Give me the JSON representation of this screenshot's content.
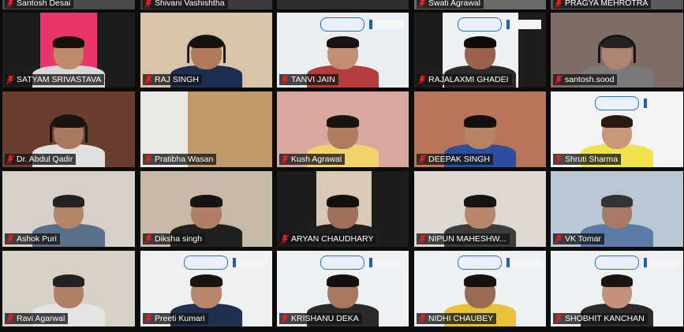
{
  "participants": [
    {
      "name": "Santosh Desai"
    },
    {
      "name": "Shivani Vashishtha"
    },
    {
      "name": ""
    },
    {
      "name": "Swati Agrawal"
    },
    {
      "name": "PRAGYA MEHROTRA"
    },
    {
      "name": "SATYAM SRIVASTAVA"
    },
    {
      "name": "RAJ SINGH"
    },
    {
      "name": "TANVI JAIN"
    },
    {
      "name": "RAJALAXMI GHADEI"
    },
    {
      "name": "santosh.sood"
    },
    {
      "name": "Dr. Abdul Qadir"
    },
    {
      "name": "Pratibha Wasan"
    },
    {
      "name": "Kush Agrawal"
    },
    {
      "name": "DEEPAK SINGH"
    },
    {
      "name": "Shruti Sharma"
    },
    {
      "name": "Ashok Puri"
    },
    {
      "name": "Diksha singh"
    },
    {
      "name": "ARYAN CHAUDHARY"
    },
    {
      "name": "NIPUN MAHESHW..."
    },
    {
      "name": "VK Tomar"
    },
    {
      "name": "Ravi Agarwal"
    },
    {
      "name": "Preeti Kumari"
    },
    {
      "name": "KRISHANU DEKA"
    },
    {
      "name": "NIDHI CHAUBEY"
    },
    {
      "name": "SHOBHIT KANCHAN"
    }
  ],
  "icons": {
    "muted": "microphone-muted-icon"
  },
  "colors": {
    "mute_red": "#e02020",
    "active_border": "#e8d84a",
    "tag_bg": "#141414"
  }
}
